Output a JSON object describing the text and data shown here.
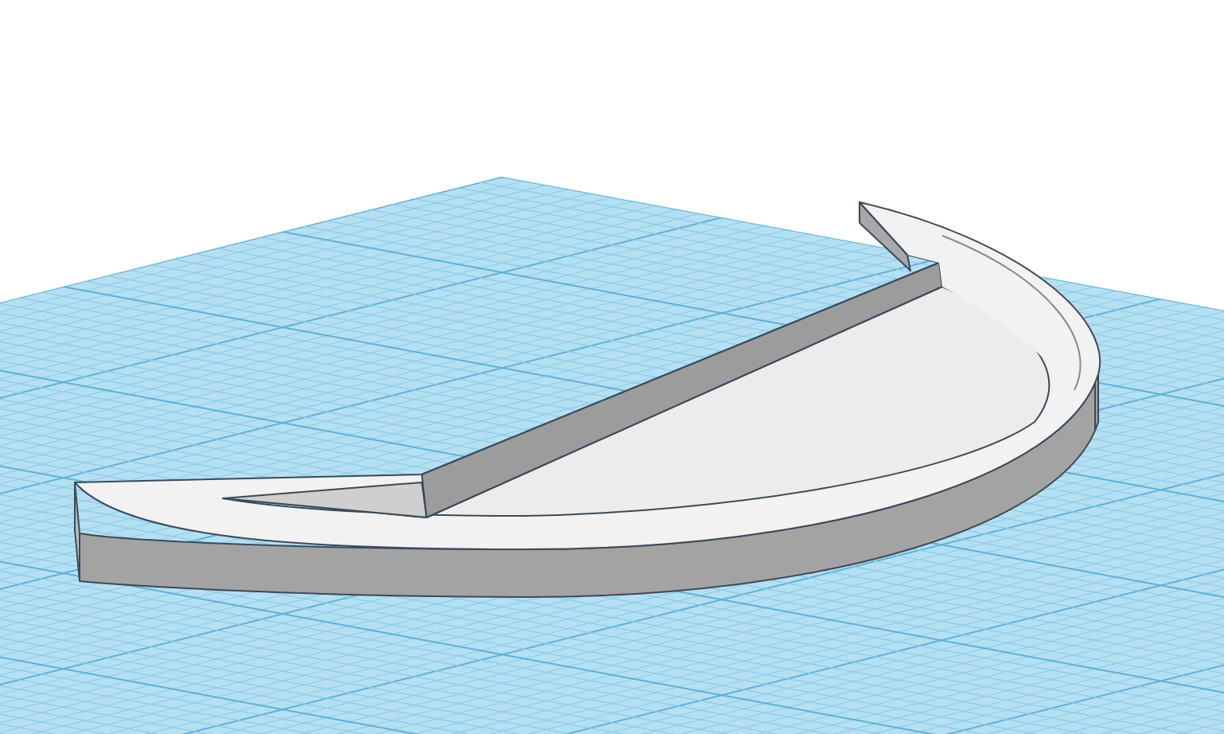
{
  "viewport": {
    "kind": "workplane"
  }
}
